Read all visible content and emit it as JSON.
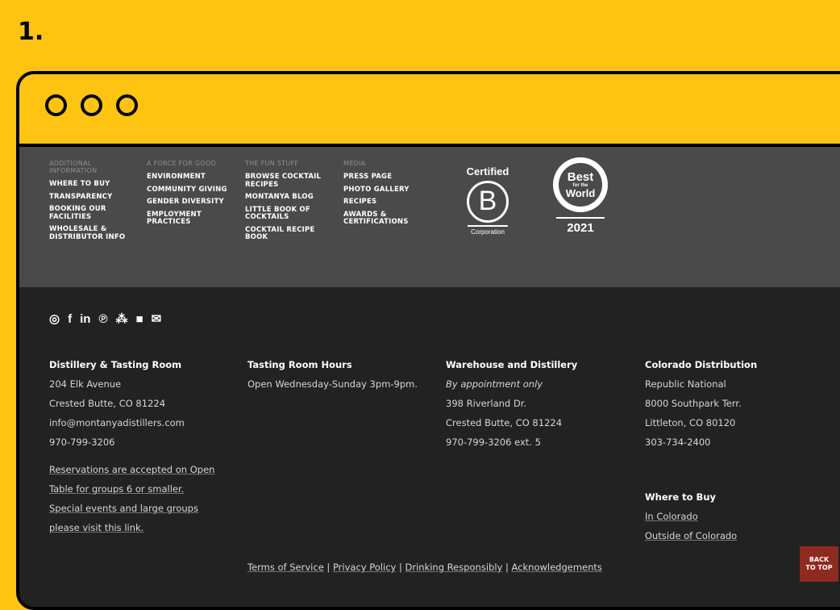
{
  "step": "1.",
  "footer_top": {
    "columns": [
      {
        "heading": "Additional Information",
        "links": [
          "Where to Buy",
          "Transparency",
          "Booking Our Facilities",
          "Wholesale & Distributor Info"
        ]
      },
      {
        "heading": "A Force For Good",
        "links": [
          "Environment",
          "Community Giving",
          "Gender Diversity",
          "Employment Practices"
        ]
      },
      {
        "heading": "The Fun Stuff",
        "links": [
          "Browse Cocktail Recipes",
          "Montanya Blog",
          "Little Book of Cocktails",
          "Cocktail Recipe Book"
        ]
      },
      {
        "heading": "Media",
        "links": [
          "Press Page",
          "Photo Gallery",
          "Recipes",
          "Awards & Certifications"
        ]
      }
    ],
    "bcorp": {
      "certified": "Certified",
      "letter": "B",
      "corporation": "Corporation"
    },
    "best_world": {
      "best": "Best",
      "for_the": "for the",
      "world": "World",
      "year": "2021"
    }
  },
  "social": [
    "instagram-icon",
    "facebook-icon",
    "linkedin-icon",
    "pinterest-icon",
    "yelp-icon",
    "youtube-icon",
    "email-icon"
  ],
  "social_glyphs": [
    "◎",
    "f",
    "in",
    "℗",
    "⁂",
    "■",
    "✉"
  ],
  "distillery": {
    "title": "Distillery & Tasting Room",
    "street": "204 Elk Avenue",
    "city": "Crested Butte, CO 81224",
    "email": "info@montanyadistillers.com",
    "phone": "970-799-3206",
    "res1": "Reservations are accepted on Open",
    "res2": "Table for groups 6 or smaller.",
    "res3": "Special events and large groups",
    "res4": "please visit this link."
  },
  "hours": {
    "title": "Tasting Room Hours",
    "text": "Open Wednesday-Sunday 3pm-9pm."
  },
  "warehouse": {
    "title": "Warehouse and Distillery",
    "note": "By appointment only",
    "street": "398 Riverland Dr.",
    "city": "Crested Butte, CO 81224",
    "phone": "970-799-3206 ext. 5"
  },
  "colorado": {
    "title": "Colorado Distribution",
    "company": "Republic National",
    "street": "8000 Southpark Terr.",
    "city": "Littleton, CO 80120",
    "phone": "303-734-2400"
  },
  "where_to_buy": {
    "title": "Where to Buy",
    "in": "In Colorado",
    "outside": "Outside of Colorado"
  },
  "legal": {
    "terms": "Terms of Service",
    "privacy": "Privacy Policy",
    "drinking": "Drinking Responsibly",
    "ack": "Acknowledgements",
    "sep": "|"
  },
  "back_to_top": {
    "line1": "BACK",
    "line2": "TO TOP"
  },
  "colors": {
    "accent": "#FFC312",
    "footer_top": "#4a4a4a",
    "footer_bottom": "#222222",
    "back_to_top": "#8e2a20"
  }
}
